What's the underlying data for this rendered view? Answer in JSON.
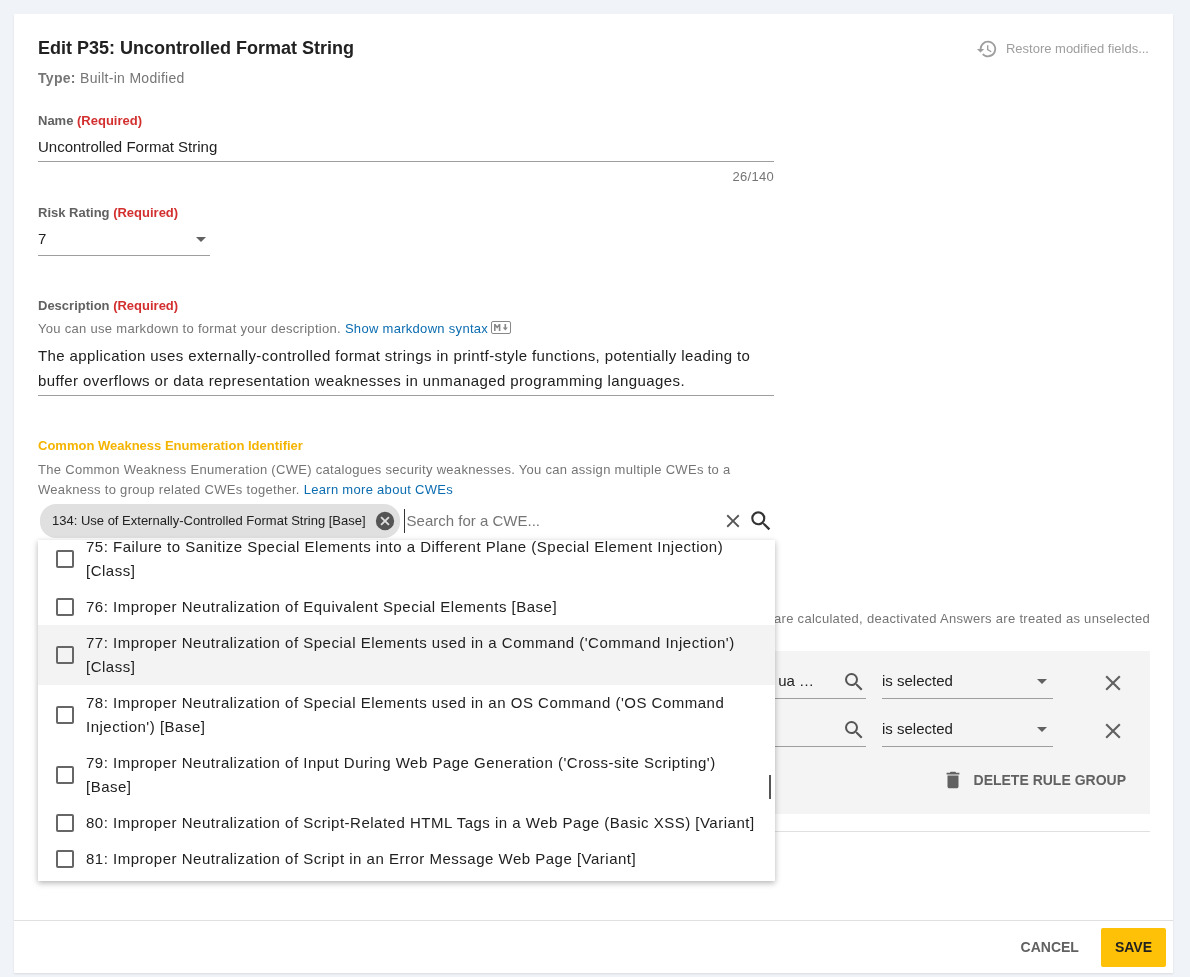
{
  "dialog": {
    "title": "Edit P35: Uncontrolled Format String",
    "type_label": "Type:",
    "type_value": "Built-in Modified",
    "restore": {
      "label": "Restore modified fields...",
      "disabled": true
    }
  },
  "name_field": {
    "label": "Name",
    "required": "(Required)",
    "value": "Uncontrolled Format String",
    "counter": "26/140"
  },
  "risk_field": {
    "label": "Risk Rating",
    "required": "(Required)",
    "value": "7"
  },
  "description_field": {
    "label": "Description",
    "required": "(Required)",
    "help": "You can use markdown to format your description.",
    "help_link": "Show markdown syntax",
    "value": "The application uses externally-controlled format strings in printf-style functions, potentially leading to buffer overflows or data representation weaknesses in unmanaged programming languages."
  },
  "cwe_field": {
    "label": "Common Weakness Enumeration Identifier",
    "focused": true,
    "help": "The Common Weakness Enumeration (CWE) catalogues security weaknesses. You can assign multiple CWEs to a Weakness to group related CWEs together.",
    "help_link": "Learn more about CWEs",
    "chips": [
      "134: Use of Externally-Controlled Format String [Base]"
    ],
    "placeholder": "Search for a CWE..."
  },
  "cwe_options": [
    {
      "label": "75: Failure to Sanitize Special Elements into a Different Plane (Special Element Injection) [Class]",
      "checked": false,
      "highlighted": false
    },
    {
      "label": "76: Improper Neutralization of Equivalent Special Elements [Base]",
      "checked": false,
      "highlighted": false
    },
    {
      "label": "77: Improper Neutralization of Special Elements used in a Command ('Command Injection') [Class]",
      "checked": false,
      "highlighted": true
    },
    {
      "label": "78: Improper Neutralization of Special Elements used in an OS Command ('OS Command Injection') [Base]",
      "checked": false,
      "highlighted": false
    },
    {
      "label": "79: Improper Neutralization of Input During Web Page Generation ('Cross-site Scripting') [Base]",
      "checked": false,
      "highlighted": false
    },
    {
      "label": "80: Improper Neutralization of Script-Related HTML Tags in a Web Page (Basic XSS) [Variant]",
      "checked": false,
      "highlighted": false
    },
    {
      "label": "81: Improper Neutralization of Script in an Error Message Web Page [Variant]",
      "checked": false,
      "highlighted": false
    }
  ],
  "rules": {
    "hint": "are calculated, deactivated Answers are treated as unselected",
    "rows": [
      {
        "answer": "ua …",
        "condition": "is selected"
      },
      {
        "answer": "",
        "condition": "is selected"
      }
    ],
    "delete_group": "DELETE RULE GROUP"
  },
  "footer": {
    "buttons": [
      {
        "label": "CANCEL",
        "kind": "text"
      },
      {
        "label": "SAVE",
        "kind": "primary"
      }
    ]
  }
}
